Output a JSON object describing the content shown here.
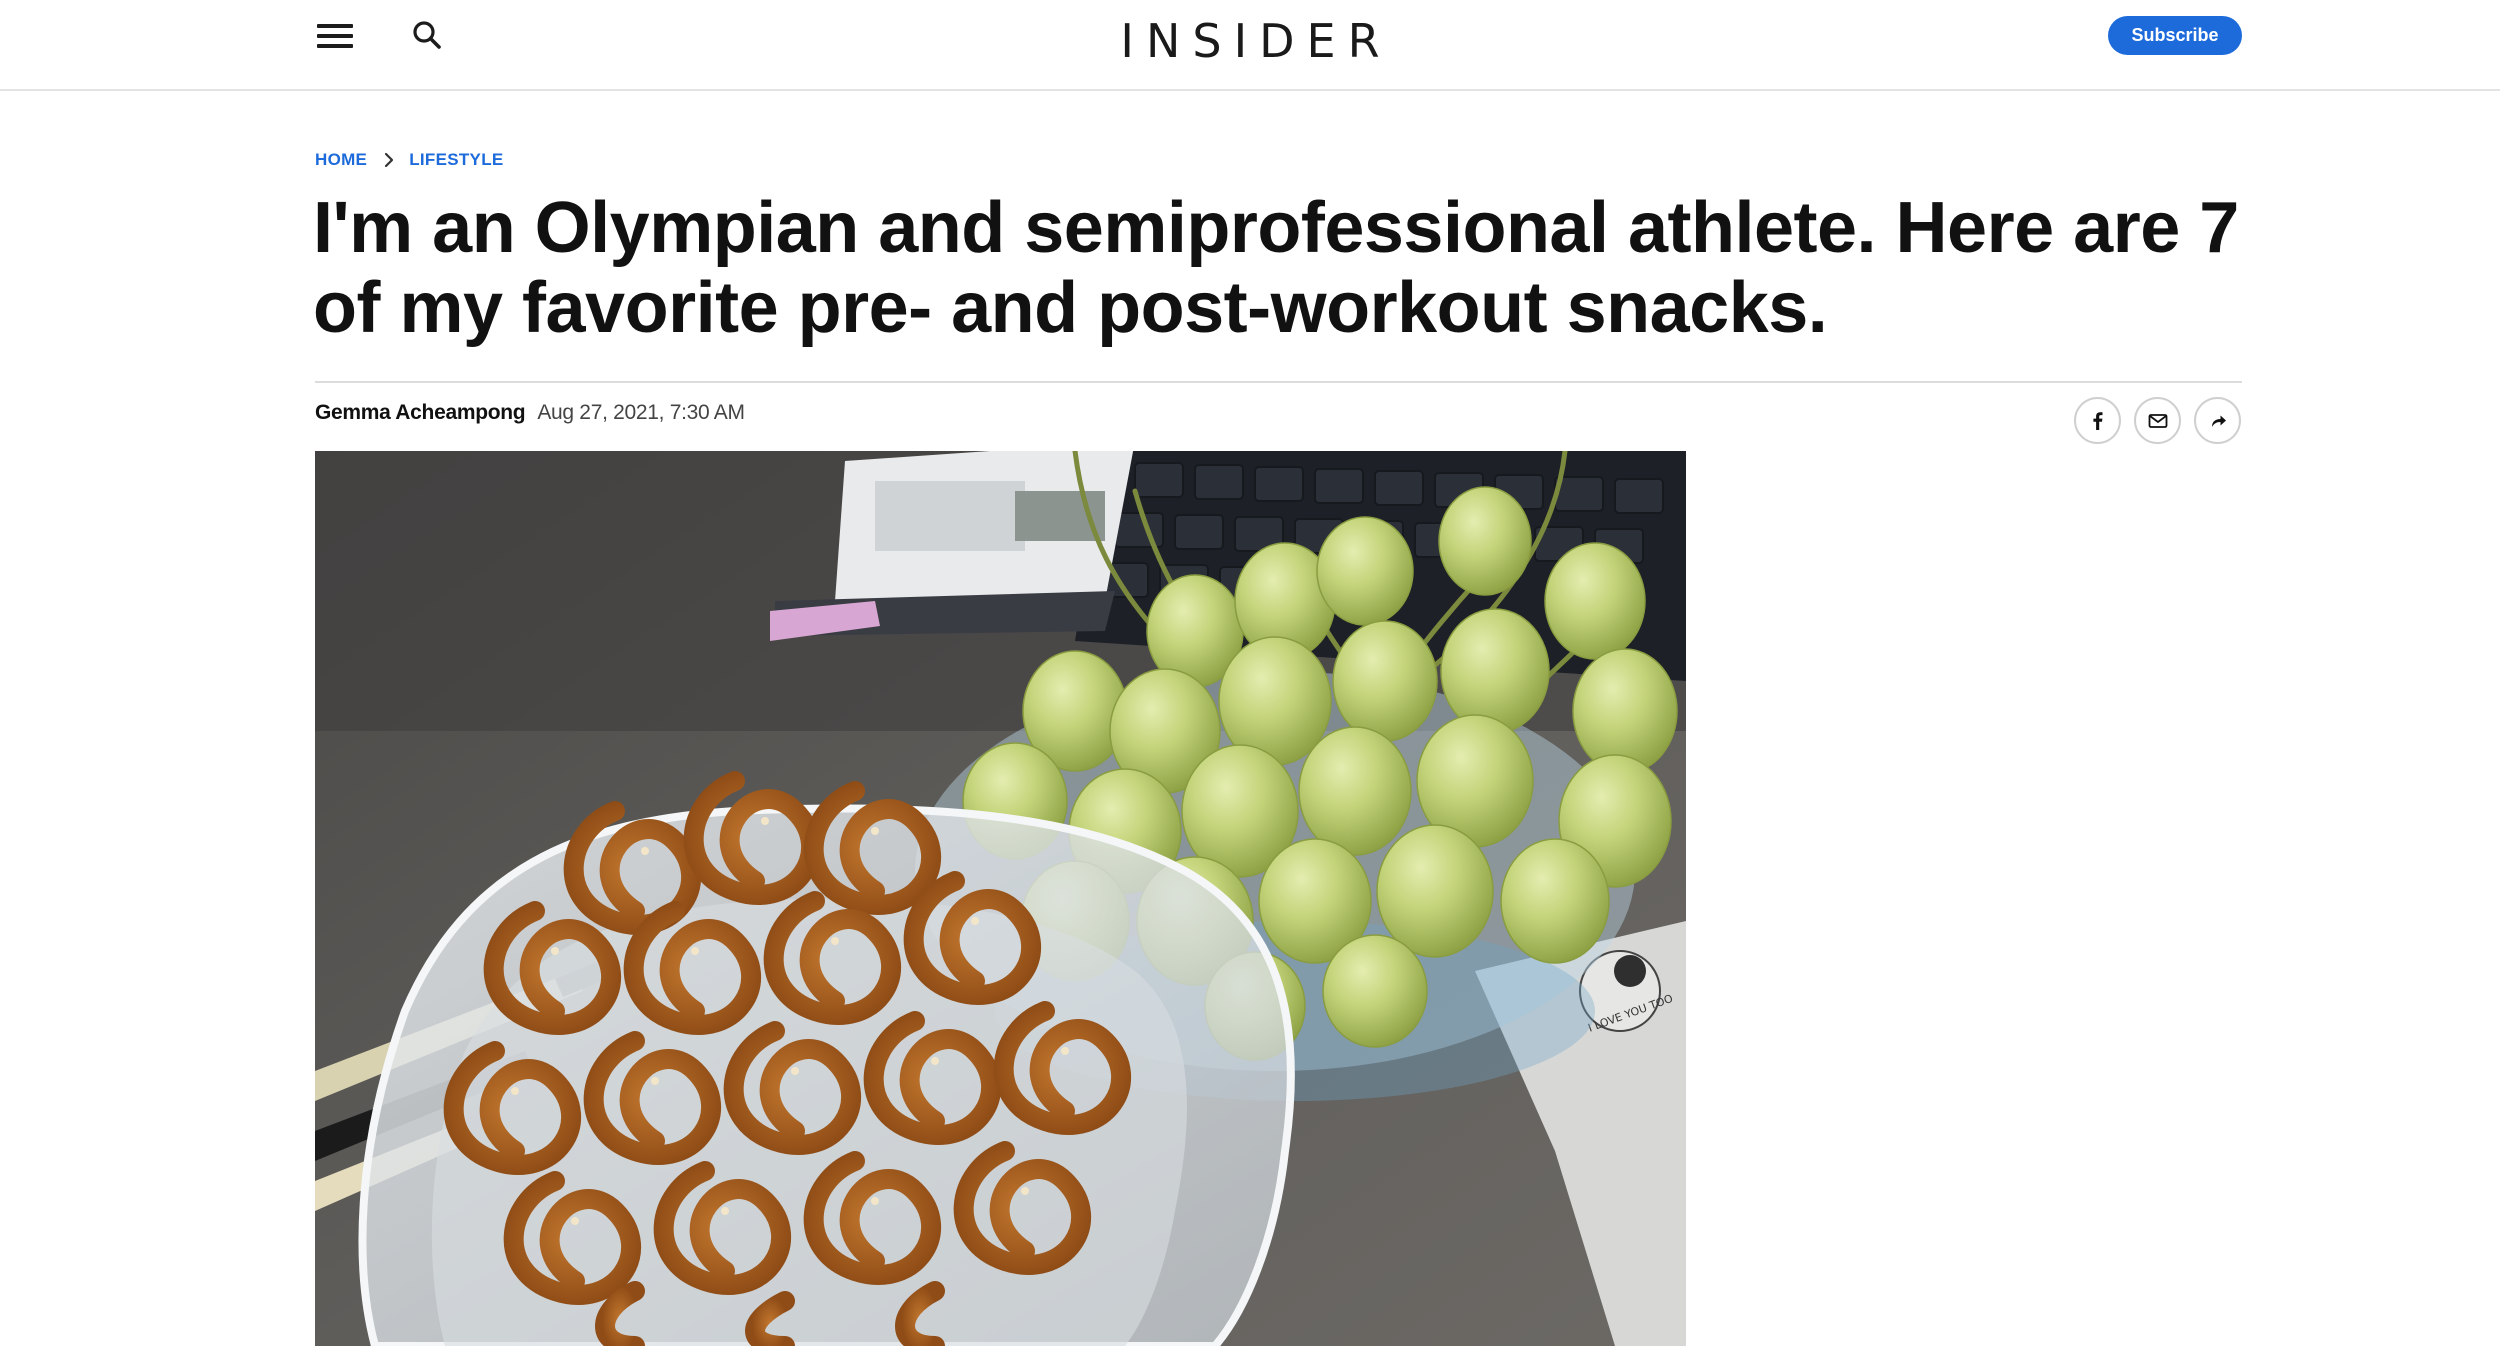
{
  "header": {
    "logo_text": "INSIDER",
    "subscribe_label": "Subscribe",
    "menu_icon": "hamburger-menu-icon",
    "search_icon": "search-icon"
  },
  "breadcrumb": {
    "items": [
      "HOME",
      "LIFESTYLE"
    ]
  },
  "article": {
    "title": "I'm an Olympian and semiprofessional athlete. Here are 7 of my favorite pre- and post-workout snacks.",
    "author": "Gemma Acheampong",
    "date": "Aug 27, 2021, 7:30 AM",
    "hero_image_subject": "pretzels-and-grapes-photo",
    "sticker_text": "I LOVE YOU TOO"
  },
  "share": {
    "icons": [
      "facebook-icon",
      "mail-icon",
      "share-arrow-icon"
    ]
  },
  "colors": {
    "accent": "#1d6bdb",
    "text": "#111111",
    "divider": "#dcdcdc"
  }
}
